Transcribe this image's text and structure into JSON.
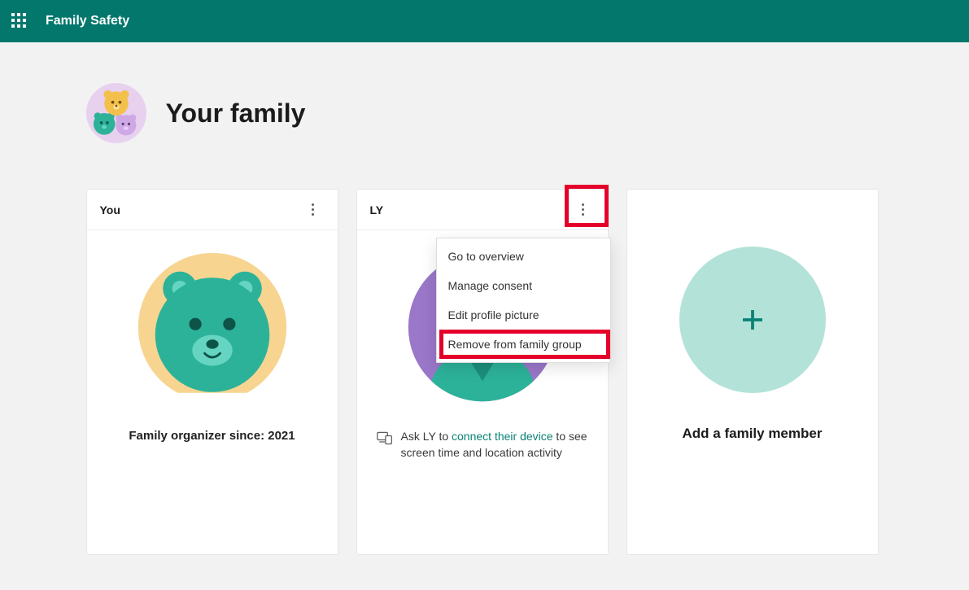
{
  "header": {
    "app_title": "Family Safety"
  },
  "page": {
    "title": "Your family"
  },
  "cards": {
    "you": {
      "title": "You",
      "caption": "Family organizer since: 2021"
    },
    "member": {
      "title": "LY",
      "ask_prefix": "Ask LY to ",
      "connect_link": "connect their device",
      "ask_suffix": " to see screen time and location activity",
      "menu": {
        "overview": "Go to overview",
        "consent": "Manage consent",
        "edit_pic": "Edit profile picture",
        "remove": "Remove from family group"
      }
    },
    "add": {
      "label": "Add a family member"
    }
  }
}
